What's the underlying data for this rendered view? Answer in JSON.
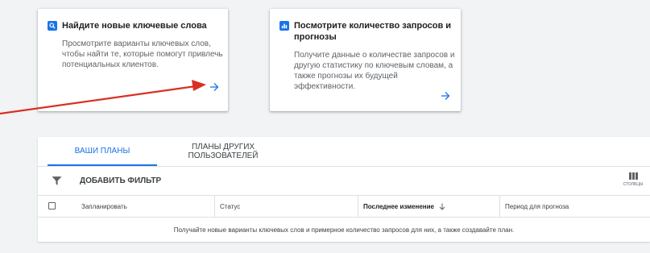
{
  "cards": [
    {
      "title": "Найдите новые ключевые слова",
      "icon": "search-icon",
      "description": "Просмотрите варианты ключевых слов, чтобы найти те, которые помогут привлечь потенциальных клиентов."
    },
    {
      "title": "Посмотрите количество запросов и прогнозы",
      "icon": "bar-chart-icon",
      "description": "Получите данные о количестве запросов и другую статистику по ключевым словам, а также прогнозы их будущей эффективности."
    }
  ],
  "plans": {
    "tabs": [
      {
        "label": "ВАШИ ПЛАНЫ",
        "active": true
      },
      {
        "label": "ПЛАНЫ ДРУГИХ ПОЛЬЗОВАТЕЛЕЙ",
        "active": false
      }
    ],
    "filter_label": "ДОБАВИТЬ ФИЛЬТР",
    "columns_label": "СТОЛБЦЫ",
    "table": {
      "headers": [
        "Запланировать",
        "Статус",
        "Последнее изменение",
        "Период для прогноза"
      ],
      "sorted_column": "Последнее изменение",
      "sort_direction": "descending",
      "empty_message": "Получайте новые варианты ключевых слов и примерное количество запросов для них, а также создавайте план."
    }
  },
  "colors": {
    "accent": "#1a73e8",
    "annotation_arrow": "#d93025",
    "background": "#f1f3f4"
  }
}
